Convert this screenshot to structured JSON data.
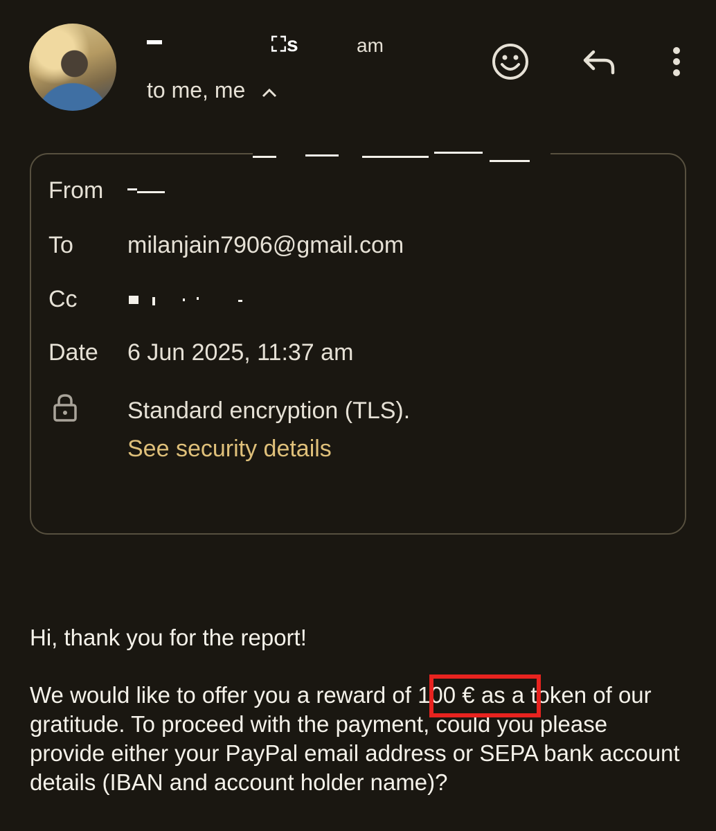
{
  "header": {
    "sender_name": "⛶s",
    "sender_time": "am",
    "recipients": "to me, me",
    "icons": {
      "emoji": "emoji-react-icon",
      "reply": "reply-icon",
      "more": "more-vert-icon",
      "expand": "chevron-up-icon"
    }
  },
  "details": {
    "from_label": "From",
    "to_label": "To",
    "to_value": "milanjain7906@gmail.com",
    "cc_label": "Cc",
    "date_label": "Date",
    "date_value": "6 Jun 2025, 11:37 am",
    "encryption_text": "Standard encryption (TLS).",
    "security_link": "See security details"
  },
  "message": {
    "greeting": "Hi, thank you for the report!",
    "paragraph": "We would like to offer you a reward of 100 € as a token of our gratitude. To proceed with the payment, could you please provide either your PayPal email address or SEPA bank account details (IBAN and account holder name)?"
  },
  "colors": {
    "background": "#1a1711",
    "link": "#dfc07a",
    "highlight": "#e8231f",
    "card_border": "#57503f"
  }
}
